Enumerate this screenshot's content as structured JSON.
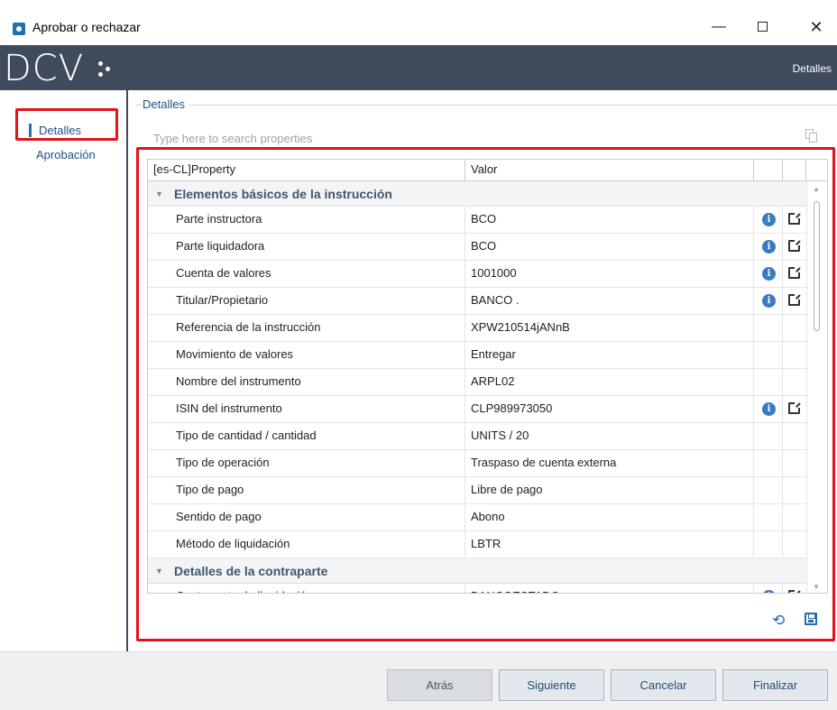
{
  "window": {
    "title": "Aprobar o rechazar",
    "minimize": "—",
    "close": "✕"
  },
  "banner": {
    "logo": "DCV",
    "right_label": "Detalles"
  },
  "nav": {
    "items": [
      {
        "label": "Detalles"
      },
      {
        "label": "Aprobación"
      }
    ]
  },
  "group": {
    "title": "Detalles",
    "search_placeholder": "Type here to search properties"
  },
  "grid": {
    "headers": {
      "property": "[es-CL]Property",
      "value": "Valor"
    },
    "categories": [
      {
        "label": "Elementos básicos de la instrucción",
        "rows": [
          {
            "property": "Parte instructora",
            "value": "BCO",
            "info": true
          },
          {
            "property": "Parte liquidadora",
            "value": "BCO",
            "info": true
          },
          {
            "property": "Cuenta de valores",
            "value": "1001000",
            "info": true
          },
          {
            "property": "Titular/Propietario",
            "value": "BANCO            .",
            "info": true
          },
          {
            "property": "Referencia de la instrucción",
            "value": "XPW210514jANnB",
            "info": false
          },
          {
            "property": "Movimiento de valores",
            "value": "Entregar",
            "info": false
          },
          {
            "property": "Nombre del instrumento",
            "value": "ARPL02",
            "info": false
          },
          {
            "property": "ISIN del instrumento",
            "value": "CLP989973050",
            "info": true
          },
          {
            "property": "Tipo de cantidad / cantidad",
            "value": "UNITS / 20",
            "info": false
          },
          {
            "property": "Tipo de operación",
            "value": "Traspaso de cuenta externa",
            "info": false
          },
          {
            "property": "Tipo de pago",
            "value": "Libre de pago",
            "info": false
          },
          {
            "property": "Sentido de pago",
            "value": "Abono",
            "info": false
          },
          {
            "property": "Método de liquidación",
            "value": "LBTR",
            "info": false
          }
        ]
      },
      {
        "label": "Detalles de la contraparte",
        "rows": [
          {
            "property": "Contraparte de liquidación",
            "value": "BANCOESTADO",
            "info": true
          }
        ]
      }
    ]
  },
  "footer": {
    "back": "Atrás",
    "next": "Siguiente",
    "cancel": "Cancelar",
    "finish": "Finalizar"
  },
  "colors": {
    "banner": "#3f4b5c",
    "highlight": "#e3121b",
    "accent": "#1f6fb2"
  },
  "icons": {
    "info": "info-icon",
    "open_link": "open-link-icon",
    "refresh": "refresh-icon",
    "save": "save-icon",
    "copy": "copy-icon"
  }
}
